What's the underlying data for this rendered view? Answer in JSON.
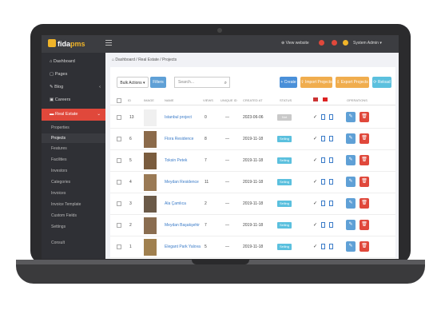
{
  "app": {
    "logo_text": "fida",
    "logo_accent": "pms"
  },
  "topbar": {
    "view_website": "View website",
    "admin": "System Admin"
  },
  "sidebar": {
    "items": [
      "Dashboard",
      "Pages",
      "Blog",
      "Careers",
      "Real Estate"
    ],
    "sub_items": [
      "Properties",
      "Projects",
      "Features",
      "Facilities",
      "Investors",
      "Categories",
      "Invoices",
      "Invoice Template",
      "Custom Fields",
      "Settings",
      "Consult"
    ]
  },
  "breadcrumb": {
    "home": "Dashboard",
    "section": "Real Estate",
    "current": "Projects"
  },
  "toolbar": {
    "bulk": "Bulk Actions",
    "filters": "Filters",
    "search_placeholder": "Search...",
    "create": "Create",
    "import": "Import Projects",
    "export": "Export Projects",
    "reload": "Reload"
  },
  "table": {
    "headers": [
      "ID",
      "IMAGE",
      "NAME",
      "VIEWS",
      "UNIQUE ID",
      "CREATED AT",
      "STATUS",
      "OPERATIONS"
    ],
    "rows": [
      {
        "id": "13",
        "name": "Istanbul project",
        "views": "0",
        "unique": "—",
        "created": "2023-06-06",
        "status": "Not available",
        "status_color": "#c9c9c9",
        "thumb": "#f0f0f0"
      },
      {
        "id": "6",
        "name": "Flora Residence",
        "views": "8",
        "unique": "—",
        "created": "2019-11-18",
        "status": "Selling",
        "status_color": "#5bc0de",
        "thumb": "#8b6a4a"
      },
      {
        "id": "5",
        "name": "Toksin Petek",
        "views": "7",
        "unique": "—",
        "created": "2019-11-18",
        "status": "Selling",
        "status_color": "#5bc0de",
        "thumb": "#7a5c3e"
      },
      {
        "id": "4",
        "name": "Meydan Residence",
        "views": "11",
        "unique": "—",
        "created": "2019-11-18",
        "status": "Selling",
        "status_color": "#5bc0de",
        "thumb": "#9a7a55"
      },
      {
        "id": "3",
        "name": "Ala Çamlıca",
        "views": "2",
        "unique": "—",
        "created": "2019-11-18",
        "status": "Selling",
        "status_color": "#5bc0de",
        "thumb": "#6b5a48"
      },
      {
        "id": "2",
        "name": "Meydan Başakşehir",
        "views": "7",
        "unique": "—",
        "created": "2019-11-18",
        "status": "Selling",
        "status_color": "#5bc0de",
        "thumb": "#8a6d50"
      },
      {
        "id": "1",
        "name": "Elegant Park Yalova",
        "views": "5",
        "unique": "—",
        "created": "2019-11-18",
        "status": "Selling",
        "status_color": "#5bc0de",
        "thumb": "#a0804f"
      }
    ]
  }
}
